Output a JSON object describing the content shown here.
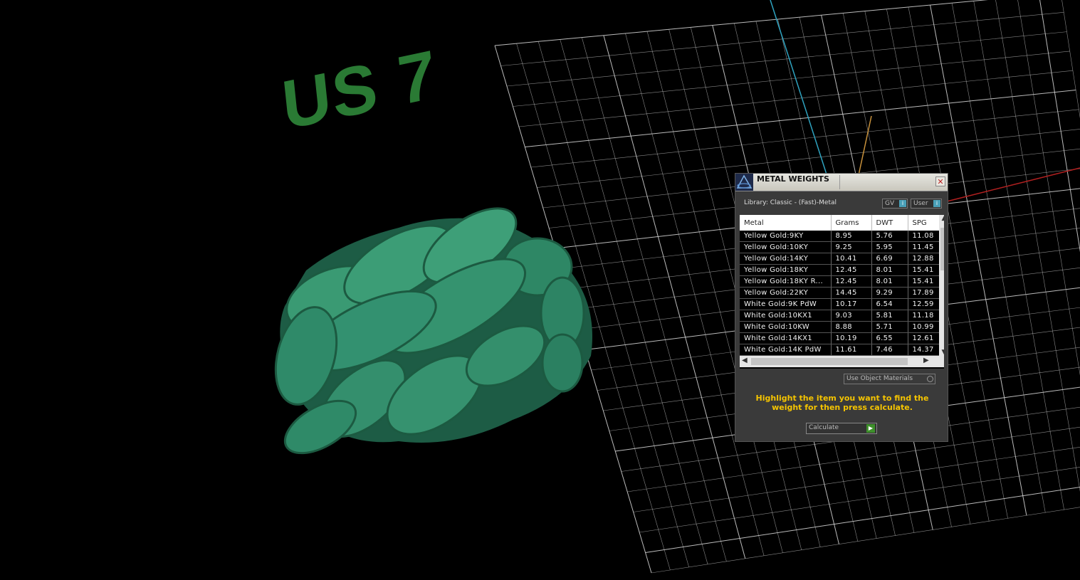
{
  "viewport": {
    "label_text": "US 7",
    "label_color": "#2a7a34",
    "model_color": "#2f8a66",
    "grid_color": "#cfcfcf",
    "axis_colors": {
      "y": "#2fa3c0",
      "x": "#b32020",
      "z": "#c9923c"
    }
  },
  "dialog": {
    "title": "METAL WEIGHTS",
    "close_symbol": "✕",
    "library_label": "Library: Classic - (Fast)-Metal",
    "toggle_gv": "GV",
    "toggle_user": "User",
    "columns": [
      "Metal",
      "Grams",
      "DWT",
      "SPG"
    ],
    "rows": [
      [
        "Yellow Gold:9KY",
        "8.95",
        "5.76",
        "11.08"
      ],
      [
        "Yellow Gold:10KY",
        "9.25",
        "5.95",
        "11.45"
      ],
      [
        "Yellow Gold:14KY",
        "10.41",
        "6.69",
        "12.88"
      ],
      [
        "Yellow Gold:18KY",
        "12.45",
        "8.01",
        "15.41"
      ],
      [
        "Yellow Gold:18KY R...",
        "12.45",
        "8.01",
        "15.41"
      ],
      [
        "Yellow Gold:22KY",
        "14.45",
        "9.29",
        "17.89"
      ],
      [
        "White Gold:9K PdW",
        "10.17",
        "6.54",
        "12.59"
      ],
      [
        "White Gold:10KX1",
        "9.03",
        "5.81",
        "11.18"
      ],
      [
        "White Gold:10KW",
        "8.88",
        "5.71",
        "10.99"
      ],
      [
        "White Gold:14KX1",
        "10.19",
        "6.55",
        "12.61"
      ],
      [
        "White Gold:14K PdW",
        "11.61",
        "7.46",
        "14.37"
      ]
    ],
    "use_object_materials": "Use Object Materials",
    "hint": "Highlight the item you want to find the weight for then press calculate.",
    "calculate_label": "Calculate"
  }
}
